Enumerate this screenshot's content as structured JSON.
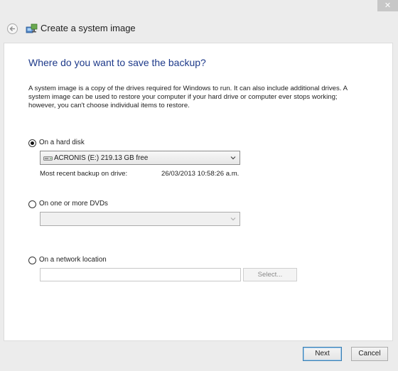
{
  "titlebar": {
    "close_glyph": "✕"
  },
  "window": {
    "title": "Create a system image",
    "icon": "system-image-icon"
  },
  "page": {
    "heading": "Where do you want to save the backup?",
    "description": "A system image is a copy of the drives required for Windows to run. It can also include additional drives. A system image can be used to restore your computer if your hard drive or computer ever stops working; however, you can't choose individual items to restore."
  },
  "options": {
    "hard_disk": {
      "label": "On a hard disk",
      "selected": true,
      "drive_value": "ACRONIS (E:)  219.13 GB free",
      "recent_label": "Most recent backup on drive:",
      "recent_value": "26/03/2013 10:58:26 a.m."
    },
    "dvd": {
      "label": "On one or more DVDs",
      "selected": false,
      "drive_value": ""
    },
    "network": {
      "label": "On a network location",
      "selected": false,
      "path_value": "",
      "select_button": "Select..."
    }
  },
  "footer": {
    "next_label": "Next",
    "cancel_label": "Cancel"
  },
  "colors": {
    "heading": "#1e3a8a",
    "accent_border": "#3c7fb1",
    "background": "#ececec"
  }
}
